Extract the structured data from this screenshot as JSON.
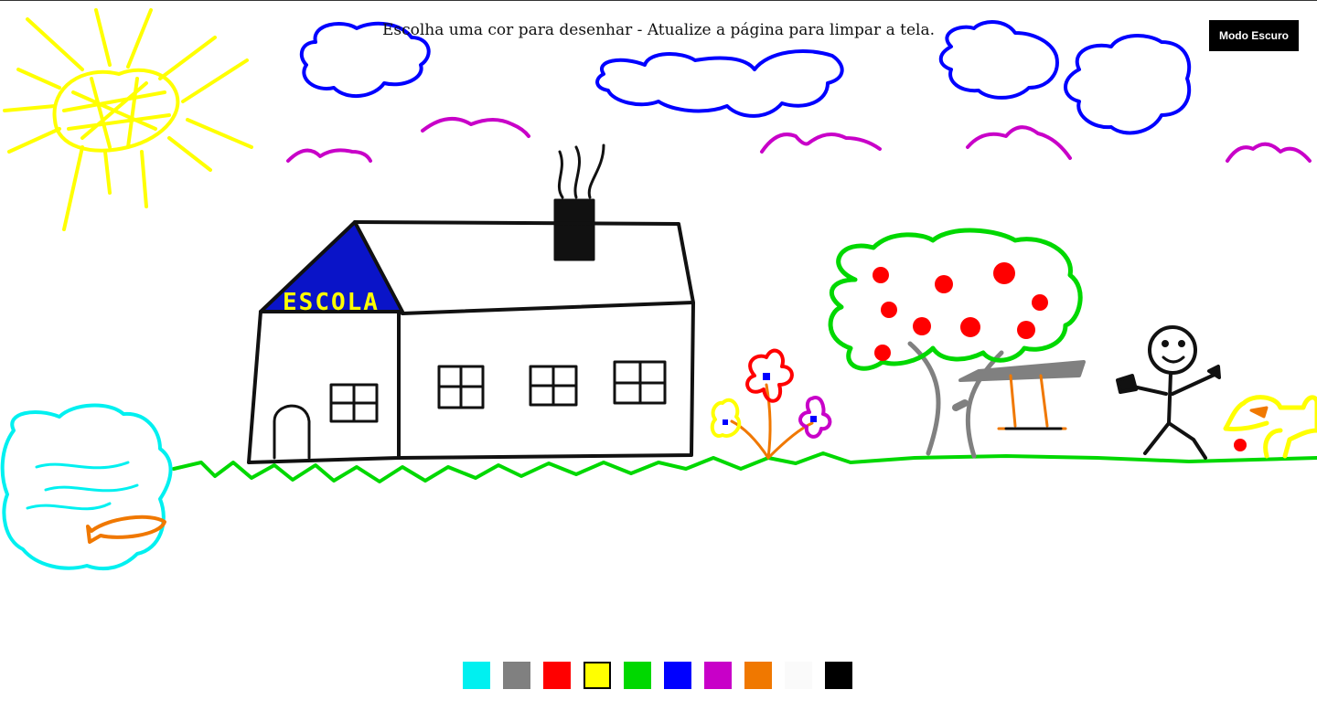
{
  "page": {
    "instruction": "Escolha uma cor para desenhar - Atualize a página para limpar a tela.",
    "dark_mode_label": "Modo Escuro"
  },
  "drawing": {
    "roof_text": "ESCOLA"
  },
  "palette": {
    "selected_index": 3,
    "colors": [
      {
        "name": "cyan",
        "hex": "#00f0f0"
      },
      {
        "name": "gray",
        "hex": "#808080"
      },
      {
        "name": "red",
        "hex": "#ff0000"
      },
      {
        "name": "yellow",
        "hex": "#ffff00"
      },
      {
        "name": "green",
        "hex": "#00d800"
      },
      {
        "name": "blue",
        "hex": "#0000ff"
      },
      {
        "name": "magenta",
        "hex": "#c800c8"
      },
      {
        "name": "orange",
        "hex": "#f07800"
      },
      {
        "name": "white",
        "hex": "#fafafa"
      },
      {
        "name": "black",
        "hex": "#000000"
      }
    ]
  }
}
